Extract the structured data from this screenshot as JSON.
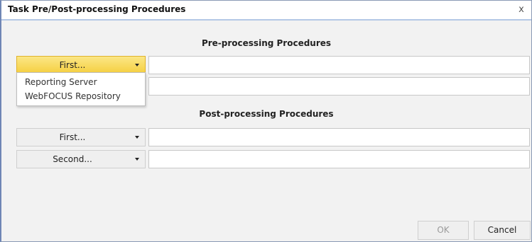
{
  "dialog": {
    "title": "Task Pre/Post-processing Procedures",
    "close_glyph": "x"
  },
  "pre": {
    "heading": "Pre-processing Procedures",
    "first_label": "First...",
    "first_value": "",
    "second_value": "",
    "menu": {
      "items": [
        {
          "label": "Reporting Server"
        },
        {
          "label": "WebFOCUS Repository"
        }
      ]
    }
  },
  "post": {
    "heading": "Post-processing Procedures",
    "first_label": "First...",
    "first_value": "",
    "second_label": "Second...",
    "second_value": ""
  },
  "footer": {
    "ok_label": "OK",
    "cancel_label": "Cancel"
  },
  "colors": {
    "active_selector": "#f5cf3f",
    "title_underline": "#b4c8e6"
  }
}
